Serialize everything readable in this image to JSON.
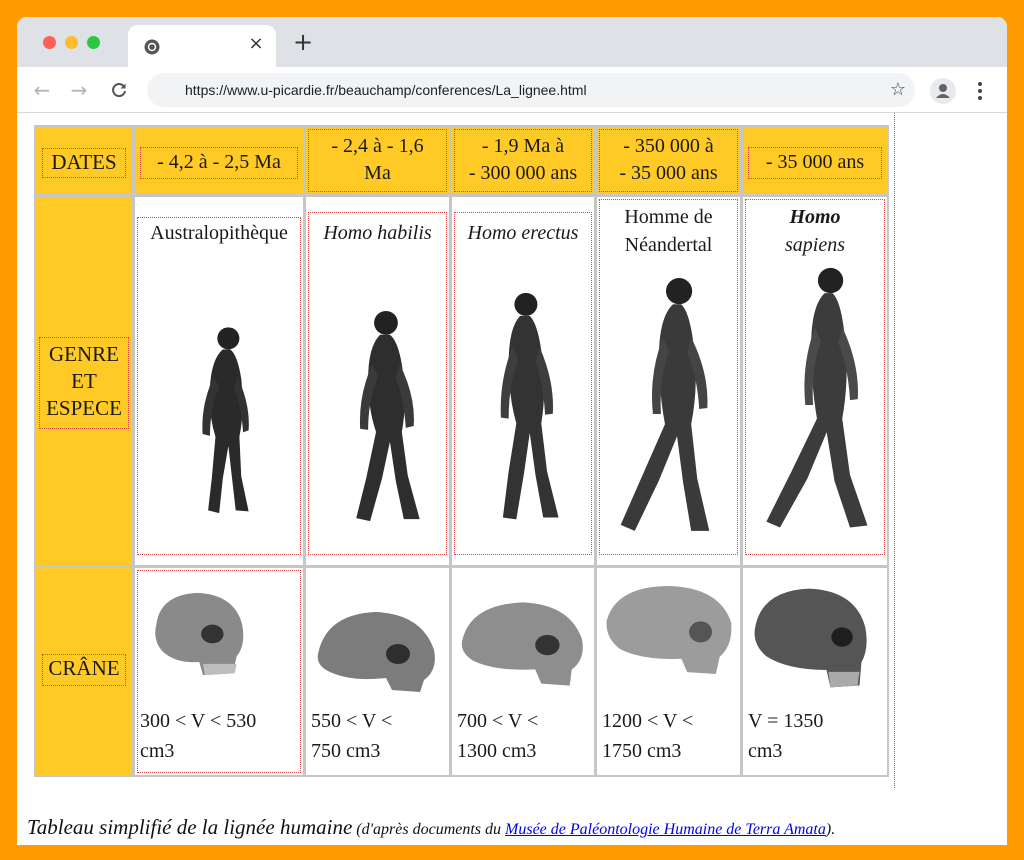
{
  "browser": {
    "tab_title": "",
    "tab_close": "×",
    "new_tab": "+",
    "back": "←",
    "forward": "→",
    "reload": "C",
    "url": "https://www.u-picardie.fr/beauchamp/conferences/La_lignee.html",
    "star": "☆"
  },
  "table": {
    "row_headers": {
      "dates": "DATES",
      "genre_line1": "GENRE",
      "genre_line2": "ET",
      "genre_line3": "ESPECE",
      "crane": "CRÂNE"
    },
    "dates": [
      {
        "l1": "- 4,2 à - 2,5 Ma",
        "l2": ""
      },
      {
        "l1": "- 2,4 à - 1,6",
        "l2": "Ma"
      },
      {
        "l1": "- 1,9 Ma à",
        "l2": "- 300 000 ans"
      },
      {
        "l1": "- 350 000 à",
        "l2": "- 35 000 ans"
      },
      {
        "l1": "- 35 000 ans",
        "l2": ""
      }
    ],
    "species": [
      {
        "l1": "Australopithèque",
        "l2": "",
        "italic": false
      },
      {
        "l1": "Homo habilis",
        "l2": "",
        "italic": true
      },
      {
        "l1": "Homo erectus",
        "l2": "",
        "italic": true
      },
      {
        "l1": "Homme de",
        "l2": "Néandertal",
        "italic": false
      },
      {
        "l1": "Homo",
        "l2": "sapiens",
        "italic": true
      }
    ],
    "volumes": [
      {
        "l1": "300 < V < 530",
        "l2": "cm3"
      },
      {
        "l1": "550 < V <",
        "l2": "750 cm3"
      },
      {
        "l1": "700 < V <",
        "l2": "1300 cm3"
      },
      {
        "l1": "1200 < V <",
        "l2": "1750 cm3"
      },
      {
        "l1": "V = 1350",
        "l2": "cm3"
      }
    ]
  },
  "caption": {
    "main": "Tableau simplifié de la lignée humaine",
    "prefix": " (d'après documents du ",
    "link": "Musée de Paléontologie Humaine de Terra Amata",
    "suffix": ")."
  },
  "colors": {
    "frame": "#ff9b00",
    "header_fill": "#ffca26",
    "dotted_border": "#d64545",
    "link": "#0000ee"
  }
}
